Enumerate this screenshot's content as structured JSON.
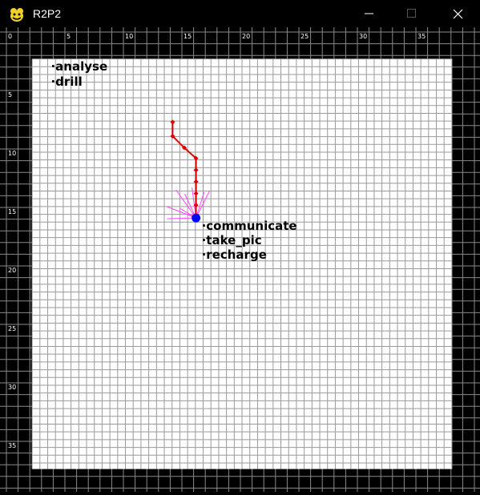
{
  "window": {
    "title": "R2P2",
    "icon": "python-snake-icon",
    "buttons": [
      "minimize-icon",
      "maximize-icon",
      "close-icon"
    ]
  },
  "axis": {
    "top_ticks": [
      "0",
      "5",
      "10",
      "15",
      "20",
      "25",
      "30",
      "35"
    ],
    "left_ticks": [
      "5",
      "10",
      "15",
      "20",
      "25",
      "30",
      "35"
    ]
  },
  "colors": {
    "background": "#000000",
    "outer_grid": "#8a8a8a",
    "field": "#ffffff",
    "inner_grid": "#9a9a9a",
    "path": "#e00000",
    "robot": "#0000ff",
    "rays": "#ff44ff",
    "label": "#000000"
  },
  "map": {
    "base_tasks": [
      "analyse",
      "drill"
    ],
    "robot_tasks": [
      "communicate",
      "take_pic",
      "recharge"
    ],
    "path_cells": [
      [
        14,
        7.7
      ],
      [
        14,
        8.9
      ],
      [
        15,
        9.9
      ],
      [
        16,
        10.8
      ],
      [
        16,
        11.8
      ],
      [
        16,
        12.8
      ],
      [
        16,
        13.8
      ],
      [
        16,
        14.8
      ]
    ],
    "robot_cell": [
      16,
      15.9
    ]
  }
}
